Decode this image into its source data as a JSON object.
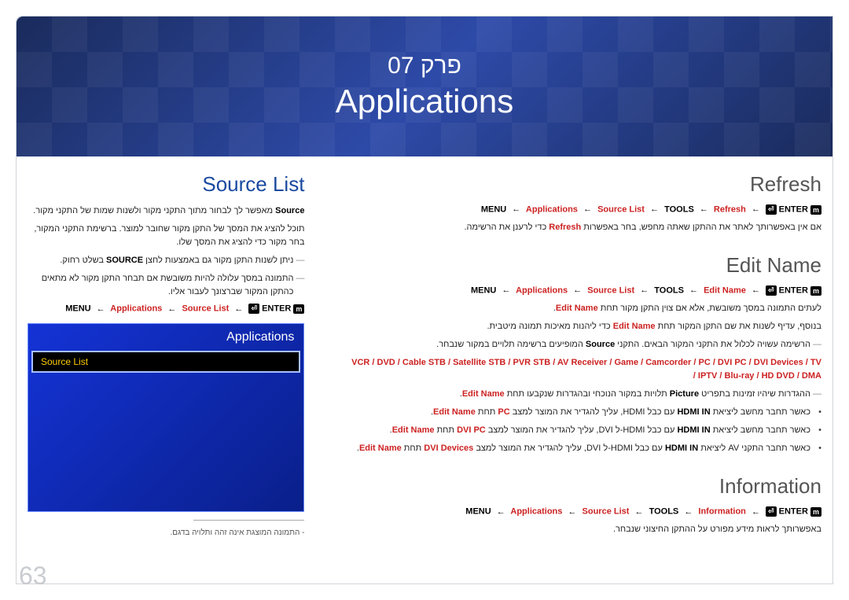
{
  "chapter": {
    "small": "פרק 07",
    "big": "Applications"
  },
  "page_number": "63",
  "right_col": {
    "title": "Source List",
    "p1": "Source מאפשר לך לבחור מתוך התקני מקור ולשנות שמות של התקני מקור.",
    "p2": "תוכל להציג את המסך של התקן מקור שחובר למוצר. ברשימת התקני המקור, בחר מקור כדי להציג את המסך שלו.",
    "p3": "ניתן לשנות התקן מקור גם באמצעות לחצן SOURCE בשלט רחוק.",
    "p4": "התמונה במסך עלולה להיות משובשת אם תבחר התקן מקור לא מתאים כהתקן המקור שברצונך לעבור אליו.",
    "nav": {
      "menu": "MENU",
      "part1": "Applications",
      "part2": "Source List",
      "enter": "ENTER"
    },
    "panel": {
      "title": "Applications",
      "item": "Source List"
    },
    "footnote": "- התמונה המוצגת אינה זהה ותלויה בדגם."
  },
  "left_col": {
    "refresh_title": "Refresh",
    "refresh_nav": {
      "menu": "MENU",
      "p1": "Applications",
      "p2": "Source List",
      "tools": "TOOLS",
      "p3": "Refresh",
      "enter": "ENTER"
    },
    "refresh_text": "אם אין באפשרותך לאתר את ההתקן שאתה מחפש, בחר באפשרות Refresh כדי לרענן את הרשימה.",
    "edit_title": "Edit Name",
    "edit_nav": {
      "menu": "MENU",
      "p1": "Applications",
      "p2": "Source List",
      "tools": "TOOLS",
      "p3": "Edit Name",
      "enter": "ENTER"
    },
    "edit_p1": "לעתים התמונה במסך משובשת, אלא אם צוין התקן מקור תחת Edit Name.",
    "edit_p2": "בנוסף, עדיף לשנות את שם התקן המקור תחת Edit Name כדי ליהנות מאיכות תמונה מיטבית.",
    "edit_p3": "הרשימה עשויה לכלול את התקני המקור הבאים. התקני Source המופיעים ברשימה תלויים במקור שנבחר.",
    "devices_line": "VCR / DVD / Cable STB / Satellite STB / PVR STB / AV Receiver / Game / Camcorder / PC / DVI PC / DVI Devices / TV / IPTV / Blu-ray / HD DVD / DMA",
    "edit_p4": "ההגדרות שיהיו זמינות בתפריט Picture תלויות במקור הנוכחי ובהגדרות שנקבעו תחת Edit Name.",
    "bullet1": "כאשר תחבר מחשב ליציאת HDMI IN עם כבל HDMI, עליך להגדיר את המוצר למצב PC תחת Edit Name.",
    "bullet2": "כאשר תחבר מחשב ליציאת HDMI IN עם כבל HDMI-ל DVI, עליך להגדיר את המוצר למצב DVI PC תחת Edit Name.",
    "bullet3": "כאשר תחבר התקני AV ליציאת HDMI IN עם כבל HDMI-ל DVI, עליך להגדיר את המוצר למצב DVI Devices תחת Edit Name.",
    "info_title": "Information",
    "info_nav": {
      "menu": "MENU",
      "p1": "Applications",
      "p2": "Source List",
      "tools": "TOOLS",
      "p3": "Information",
      "enter": "ENTER"
    },
    "info_text": "באפשרותך לראות מידע מפורט על ההתקן החיצוני שנבחר."
  }
}
